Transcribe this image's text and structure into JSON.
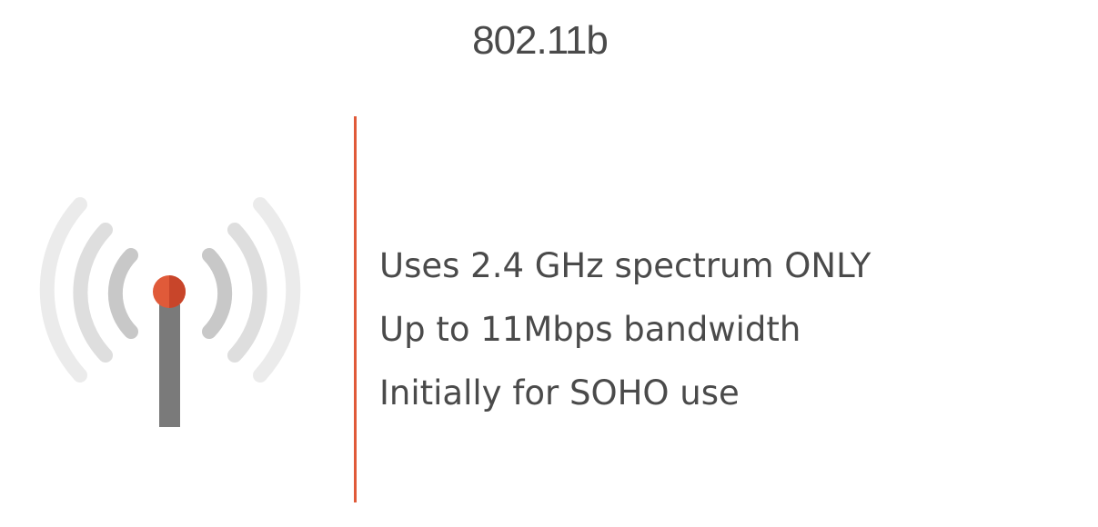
{
  "slide": {
    "title": "802.11b",
    "bullets": [
      "Uses 2.4 GHz spectrum ONLY",
      "Up to 11Mbps bandwidth",
      "Initially for SOHO use"
    ]
  },
  "icon": {
    "name": "wireless-antenna-icon",
    "accent_color": "#e05a39",
    "mast_color": "#7a7a7a",
    "wave_colors": [
      "#c8c8c8",
      "#dedede",
      "#ebebeb"
    ]
  },
  "divider_color": "#e05a39"
}
